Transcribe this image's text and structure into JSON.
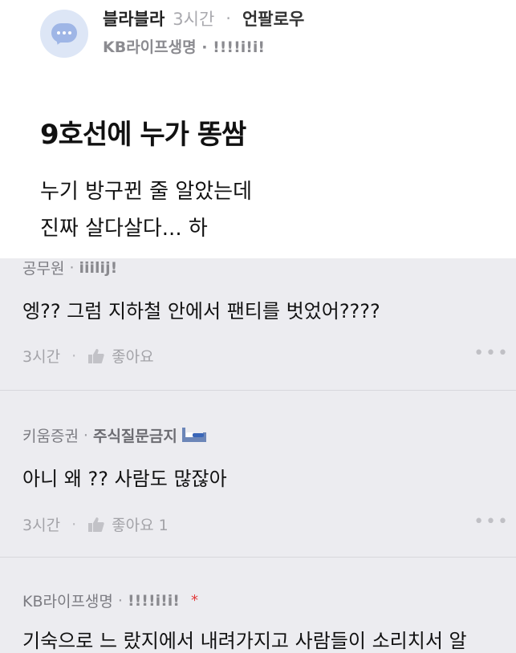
{
  "post": {
    "author": "블라블라",
    "time": "3시간",
    "separator": "·",
    "unfollow_label": "언팔로우",
    "company": "KB라이프생명",
    "badge_separator": "·",
    "badge": "!!!!i!i!",
    "title": "9호선에 누가 똥쌈",
    "body_lines": [
      "누기 방구뀐 줄 알았는데",
      "진짜 살다살다... 하"
    ]
  },
  "comments": [
    {
      "company": "공무원",
      "separator": "·",
      "badge": "iiilij!",
      "text": "엥?? 그럼 지하철 안에서 팬티를 벗었어????",
      "time": "3시간",
      "like_label": "좋아요",
      "more": "•••"
    },
    {
      "company": "키움증권",
      "separator": "·",
      "badge": "주식질문금지",
      "text": "아니 왜 ?? 사람도 많잖아",
      "time": "3시간",
      "like_label": "좋아요 1",
      "more": "•••"
    },
    {
      "company": "KB라이프생명",
      "separator": "·",
      "badge": "!!!!i!i!",
      "author_mark": "*",
      "text": "기숙으로 느 랐지에서 내려가지고 사람들이 소리치서 알"
    }
  ],
  "icons": {
    "avatar": "chat-bubble-avatar",
    "like": "thumbs-up-icon",
    "more": "more-dots-icon",
    "bed": "bed-emoji-icon"
  },
  "colors": {
    "background": "#ececf0",
    "post_background": "#ffffff",
    "avatar_bg": "#dde6f6",
    "avatar_bubble": "#9fb6e6",
    "author_mark": "#e23b3b"
  }
}
